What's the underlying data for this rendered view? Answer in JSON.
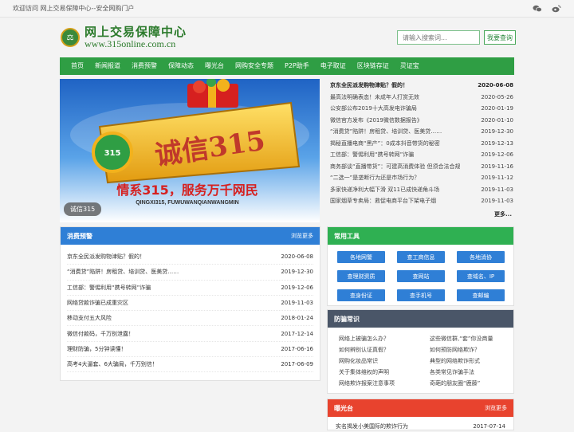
{
  "topbar": {
    "welcome": "欢迎访问 网上交易保障中心--安全网购门户"
  },
  "logo": {
    "name": "网上交易保障中心",
    "url": "www.315online.com.cn"
  },
  "search": {
    "placeholder": "请输入搜索词...",
    "button": "我要查询"
  },
  "nav": [
    "首页",
    "新闻报道",
    "消费预警",
    "保障动态",
    "曝光台",
    "网购安全专题",
    "P2P助手",
    "电子取证",
    "区块链存证",
    "灵证宝"
  ],
  "banner": {
    "caption": "诚信315",
    "headline": "诚信315",
    "slogan": "情系315，服务万千网民",
    "pinyin": "QINGXI315, FUWUWANQIANWANGMIN",
    "colors": {
      "sky": "#3a7fd4",
      "gold": "#f2b21c",
      "red": "#d6201f"
    }
  },
  "news": [
    {
      "title": "京东全民派发购物津贴？假的！",
      "date": "2020-06-08",
      "hl": true
    },
    {
      "title": "最高法明确表态！未成年人打赏无效",
      "date": "2020-05-26"
    },
    {
      "title": "公安部公布2019十大高发电诈骗局",
      "date": "2020-01-19"
    },
    {
      "title": "微信官方发布《2019微信数据报告》",
      "date": "2020-01-10"
    },
    {
      "title": "“消费贷”陷阱！房租贷、培训贷、医美贷……",
      "date": "2019-12-30"
    },
    {
      "title": "揭秘直播电商“黑产”：0成本抖音带货的秘密",
      "date": "2019-12-13"
    },
    {
      "title": "工信部：警惕利用“携号转网”诈骗",
      "date": "2019-12-06"
    },
    {
      "title": "商务部谈“直播带货”：可建高消费体验 但须合法合规",
      "date": "2019-11-16"
    },
    {
      "title": "“二选一”是垄断行为还是市场行为？",
      "date": "2019-11-12"
    },
    {
      "title": "多家快递净利大幅下滑 双11已成快递角斗场",
      "date": "2019-11-03"
    },
    {
      "title": "国家烟草专卖局：救促电商平台下架电子烟",
      "date": "2019-11-03"
    }
  ],
  "news_more": "更多...",
  "alerts": {
    "title": "消费预警",
    "more": "浏览更多",
    "items": [
      {
        "title": "京东全民派发购物津贴？假的！",
        "date": "2020-06-08"
      },
      {
        "title": "“消费贷”陷阱！房租贷、培训贷、医美贷……",
        "date": "2019-12-30"
      },
      {
        "title": "工信部：警惕利用“携号转网”诈骗",
        "date": "2019-12-06"
      },
      {
        "title": "网络贷款诈骗已成重灾区",
        "date": "2019-11-03"
      },
      {
        "title": "移动支付五大风险",
        "date": "2018-01-24"
      },
      {
        "title": "微信付款码，千万别泄露！",
        "date": "2017-12-14"
      },
      {
        "title": "理财防骗，5分钟读懂！",
        "date": "2017-06-16"
      },
      {
        "title": "高考4大逼套、6大骗局，千万别信！",
        "date": "2017-06-09"
      }
    ]
  },
  "tools": {
    "title": "常用工具",
    "items": [
      "各地网警",
      "查工商信息",
      "各地消协",
      "查理财资质",
      "查网站",
      "查域名、IP",
      "查身份证",
      "查手机号",
      "查邮编"
    ]
  },
  "anti": {
    "title": "防骗常识",
    "items": [
      "网络上被骗怎么办？",
      "这些微信群,“套”你没商量",
      "如何辨别认证真假？",
      "如何预防网络欺诈？",
      "网购化妆品常识",
      "典型的网络欺诈形式",
      "关于集体维权的声明",
      "各类常见诈骗手法",
      "网络欺诈报案注意事项",
      "奇葩的朋友圈“鹿藤”"
    ]
  },
  "exposure": {
    "title": "曝光台",
    "more": "浏览更多",
    "items": [
      {
        "title": "实名揭发小美国际的欺诈行为",
        "date": "2017-07-14"
      }
    ]
  }
}
